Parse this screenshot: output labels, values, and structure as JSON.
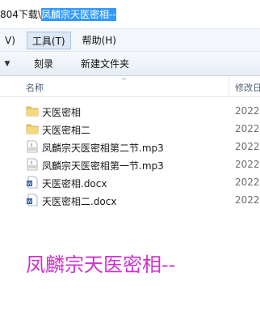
{
  "address": {
    "path_prefix": "804下载\\",
    "path_selected": "凤麟宗天医密相--"
  },
  "menubar": {
    "items": [
      {
        "label": "V)"
      },
      {
        "label": "工具(T)"
      },
      {
        "label": "帮助(H)"
      }
    ]
  },
  "toolbar": {
    "burn_label": "刻录",
    "new_folder_label": "新建文件夹"
  },
  "columns": {
    "name": "名称",
    "date": "修改日"
  },
  "files": [
    {
      "name": "天医密相",
      "date": "2022",
      "type": "folder"
    },
    {
      "name": "天医密相二",
      "date": "2022",
      "type": "folder"
    },
    {
      "name": "凤麟宗天医密相第二节.mp3",
      "date": "2022",
      "type": "mp3"
    },
    {
      "name": "凤麟宗天医密相第一节.mp3",
      "date": "2022",
      "type": "mp3"
    },
    {
      "name": "天医密相.docx",
      "date": "2022",
      "type": "docx"
    },
    {
      "name": "天医密相二.docx",
      "date": "2022",
      "type": "docx"
    }
  ],
  "caption": "凤麟宗天医密相--",
  "colors": {
    "selection": "#3399ff",
    "caption": "#cc33cc",
    "folder": "#e8c25a"
  }
}
